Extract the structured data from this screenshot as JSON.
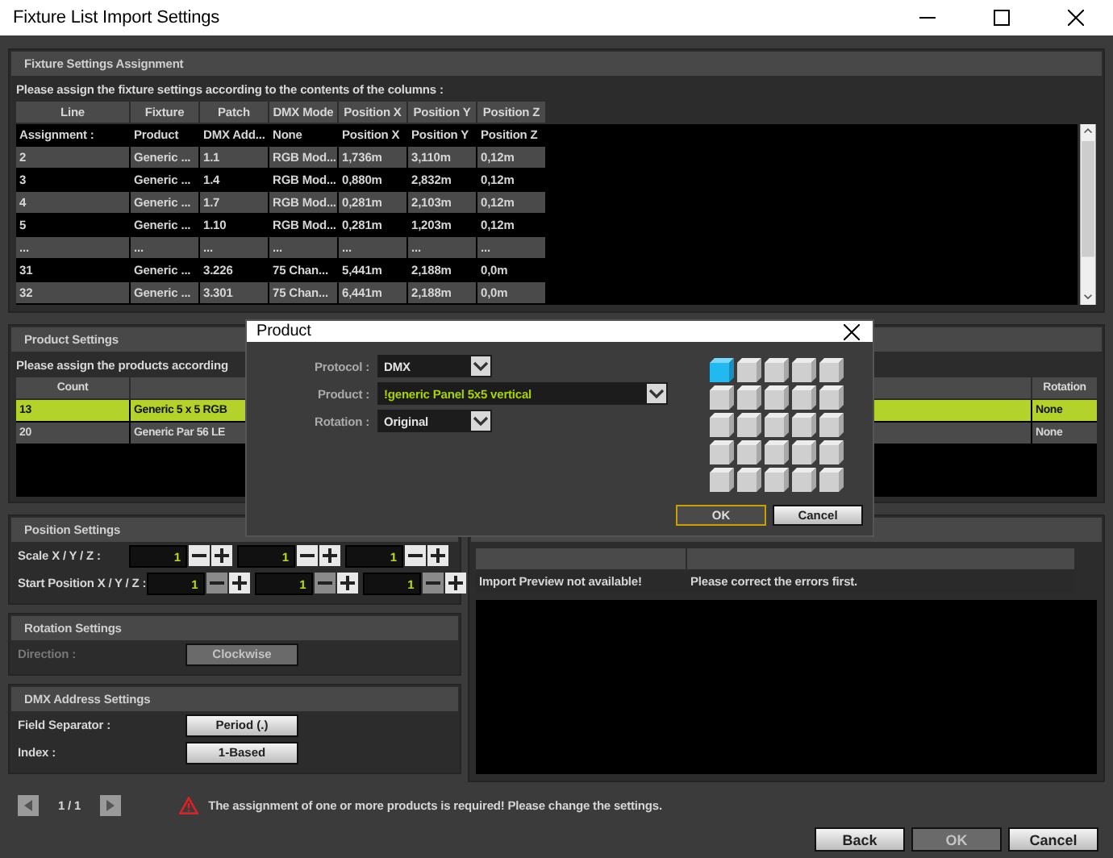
{
  "window": {
    "title": "Fixture List Import Settings"
  },
  "fixture_settings": {
    "title": "Fixture Settings Assignment",
    "instruction": "Please assign the fixture settings according to the contents of the columns :",
    "columns": [
      "Line",
      "Fixture",
      "Patch",
      "DMX Mode",
      "Position X",
      "Position Y",
      "Position Z"
    ],
    "assignment": [
      "Assignment :",
      "Product",
      "DMX Add...",
      "None",
      "Position X",
      "Position Y",
      "Position Z"
    ],
    "rows": [
      [
        "2",
        "Generic ...",
        "1.1",
        "RGB Mod...",
        "1,736m",
        "3,110m",
        "0,12m"
      ],
      [
        "3",
        "Generic ...",
        "1.4",
        "RGB Mod...",
        "0,880m",
        "2,832m",
        "0,12m"
      ],
      [
        "4",
        "Generic ...",
        "1.7",
        "RGB Mod...",
        "0,281m",
        "2,103m",
        "0,12m"
      ],
      [
        "5",
        "Generic ...",
        "1.10",
        "RGB Mod...",
        "0,281m",
        "1,203m",
        "0,12m"
      ],
      [
        "...",
        "...",
        "...",
        "...",
        "...",
        "...",
        "..."
      ],
      [
        "31",
        "Generic ...",
        "3.226",
        "75 Chan...",
        "5,441m",
        "2,188m",
        "0,0m"
      ],
      [
        "32",
        "Generic ...",
        "3.301",
        "75 Chan...",
        "6,441m",
        "2,188m",
        "0,0m"
      ]
    ]
  },
  "product_settings": {
    "title": "Product Settings",
    "instruction": "Please assign the products according",
    "columns": [
      "Count",
      "Rotation"
    ],
    "rows": [
      {
        "count": "13",
        "product": "Generic 5 x 5 RGB",
        "rotation": "None",
        "selected": true
      },
      {
        "count": "20",
        "product": "Generic Par 56 LE",
        "rotation": "None",
        "selected": false
      }
    ]
  },
  "position_settings": {
    "title": "Position Settings",
    "rows": [
      {
        "label": "Scale X / Y / Z :",
        "values": [
          {
            "value": "1",
            "minus_disabled": false
          },
          {
            "value": "1",
            "minus_disabled": false
          },
          {
            "value": "1",
            "minus_disabled": false
          }
        ]
      },
      {
        "label": "Start Position X / Y / Z :",
        "values": [
          {
            "value": "1",
            "minus_disabled": true
          },
          {
            "value": "1",
            "minus_disabled": true
          },
          {
            "value": "1",
            "minus_disabled": true
          }
        ]
      }
    ]
  },
  "rotation_settings": {
    "title": "Rotation Settings",
    "label": "Direction :",
    "button": "Clockwise",
    "disabled": true
  },
  "dmx_address_settings": {
    "title": "DMX Address Settings",
    "rows": [
      {
        "label": "Field Separator :",
        "button": "Period (.)"
      },
      {
        "label": "Index :",
        "button": "1-Based"
      }
    ]
  },
  "import_preview": {
    "rows": [
      [
        "Import Preview not available!",
        "Please correct the errors first."
      ]
    ]
  },
  "footer": {
    "page": "1 / 1",
    "message": "The assignment of one or more products is required! Please change the settings.",
    "buttons": [
      {
        "label": "Back",
        "disabled": false
      },
      {
        "label": "OK",
        "disabled": true
      },
      {
        "label": "Cancel",
        "disabled": false
      }
    ]
  },
  "product_dialog": {
    "title": "Product",
    "fields": [
      {
        "label": "Protocol :",
        "value": "DMX",
        "kind": "dropdown"
      },
      {
        "label": "Product :",
        "value": "!generic Panel 5x5 vertical",
        "kind": "product"
      },
      {
        "label": "Rotation :",
        "value": "Original",
        "kind": "dropdown"
      }
    ],
    "pixels": [
      {
        "selected": true
      },
      {
        "selected": false
      },
      {
        "selected": false
      },
      {
        "selected": false
      },
      {
        "selected": false
      },
      {
        "selected": false
      },
      {
        "selected": false
      },
      {
        "selected": false
      },
      {
        "selected": false
      },
      {
        "selected": false
      },
      {
        "selected": false
      },
      {
        "selected": false
      },
      {
        "selected": false
      },
      {
        "selected": false
      },
      {
        "selected": false
      },
      {
        "selected": false
      },
      {
        "selected": false
      },
      {
        "selected": false
      },
      {
        "selected": false
      },
      {
        "selected": false
      },
      {
        "selected": false
      },
      {
        "selected": false
      },
      {
        "selected": false
      },
      {
        "selected": false
      },
      {
        "selected": false
      }
    ],
    "buttons": [
      {
        "label": "OK",
        "focused": true
      },
      {
        "label": "Cancel",
        "focused": false
      }
    ]
  }
}
